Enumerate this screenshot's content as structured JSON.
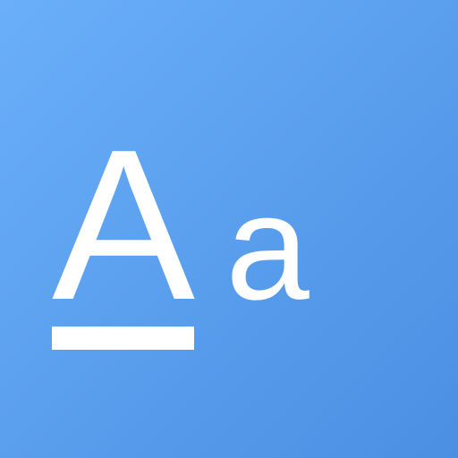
{
  "app_icon": {
    "uppercase_letter": "A",
    "lowercase_letter": "a",
    "icon_name": "font-size-icon",
    "colors": {
      "background_start": "#6aaff9",
      "background_end": "#4a8fe2",
      "glyph": "#ffffff"
    }
  }
}
